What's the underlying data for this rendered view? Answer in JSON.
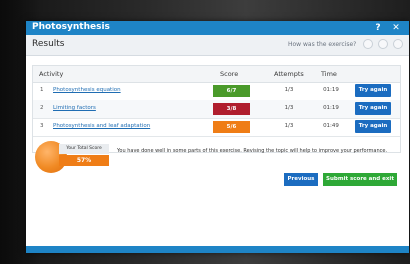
{
  "window": {
    "title": "Photosynthesis",
    "help_label": "?",
    "close_label": "✕"
  },
  "header": {
    "section": "Results",
    "rating_question": "How was the exercise?",
    "rating_icons": [
      "smiley-face-icon",
      "neutral-face-icon",
      "sad-face-icon"
    ]
  },
  "table": {
    "columns": {
      "activity": "Activity",
      "score": "Score",
      "attempts": "Attempts",
      "time": "Time"
    },
    "rows": [
      {
        "num": "1",
        "activity": "Photosynthesis equation",
        "score": "6/7",
        "score_color": "#4a9a2a",
        "attempts": "1/3",
        "time": "01:19",
        "action": "Try again"
      },
      {
        "num": "2",
        "activity": "Limiting factors",
        "score": "3/8",
        "score_color": "#b01e2e",
        "attempts": "1/3",
        "time": "01:19",
        "action": "Try again"
      },
      {
        "num": "3",
        "activity": "Photosynthesis and leaf adaptation",
        "score": "5/6",
        "score_color": "#ef7d16",
        "attempts": "1/3",
        "time": "01:49",
        "action": "Try again"
      }
    ]
  },
  "summary": {
    "total_label": "Your Total Score",
    "total_value": "57%",
    "feedback": "You have done well in some parts of this exercise. Revising the topic will help to improve your performance."
  },
  "actions": {
    "previous": "Previous",
    "submit": "Submit score and exit"
  },
  "colors": {
    "title_bar": "#1e84c6",
    "primary_button": "#1b6cc0",
    "submit_button": "#2ea836",
    "total_score": "#ef7d16"
  }
}
